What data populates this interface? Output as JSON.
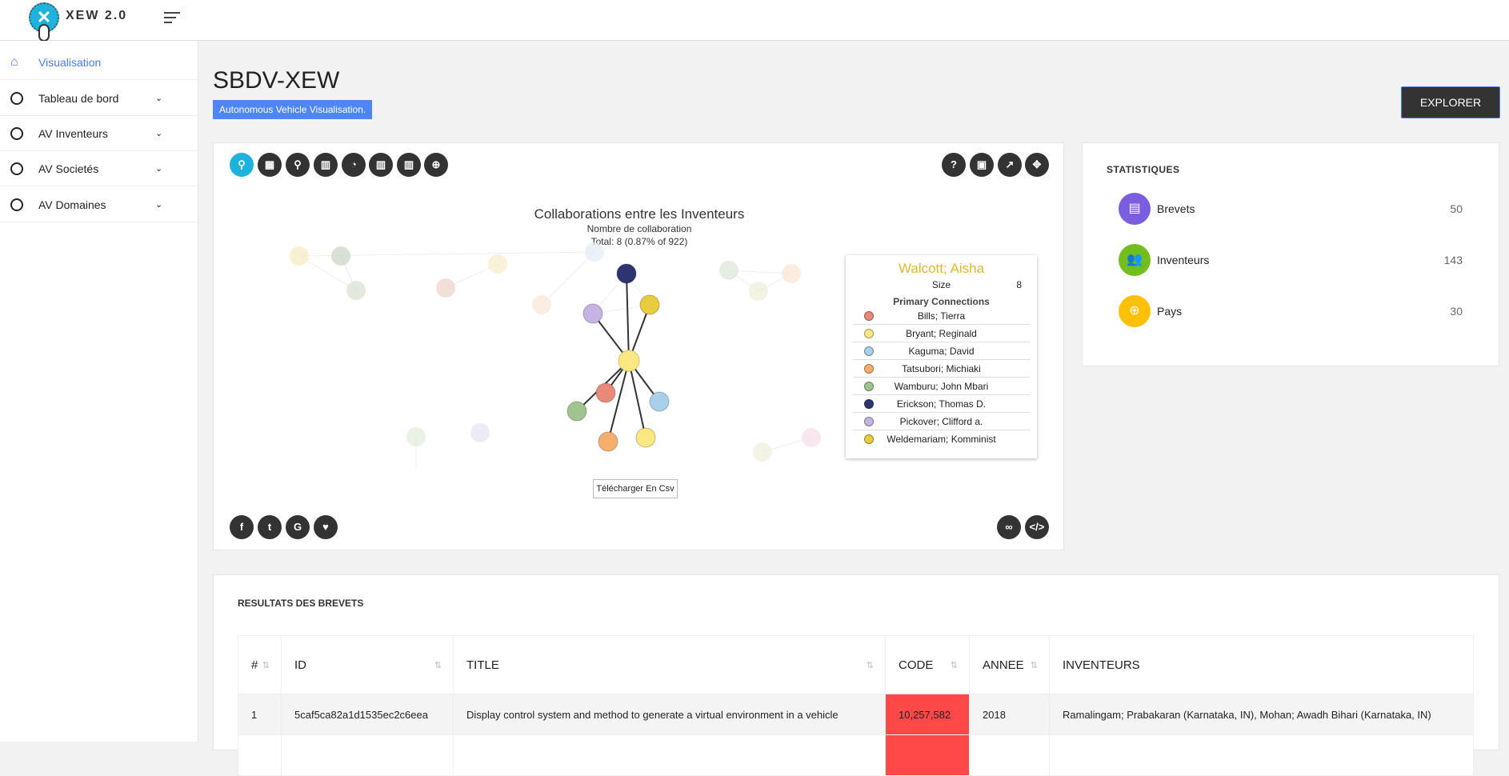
{
  "app": {
    "logo_text": "XEW 2.0"
  },
  "sidebar": {
    "items": [
      {
        "label": "Visualisation",
        "active": true,
        "icon": "home-icon"
      },
      {
        "label": "Tableau de bord",
        "icon": "circle-icon"
      },
      {
        "label": "AV Inventeurs",
        "icon": "circle-icon"
      },
      {
        "label": "AV Societés",
        "icon": "circle-icon"
      },
      {
        "label": "AV Domaines",
        "icon": "circle-icon"
      }
    ]
  },
  "header": {
    "title": "SBDV-XEW",
    "subtitle": "Autonomous Vehicle Visualisation.",
    "explorer_label": "EXPLORER"
  },
  "chart_panel": {
    "toolbar_icons": [
      "network-icon",
      "building-icon",
      "network-icon",
      "bar-chart-icon",
      "pie-chart-icon",
      "bar-chart-icon",
      "bar-chart-icon",
      "globe-icon"
    ],
    "toolbar_right_icons": [
      "help-icon",
      "image-icon",
      "share-icon",
      "move-icon"
    ],
    "social_icons": [
      "facebook-icon",
      "twitter-icon",
      "google-icon",
      "heart-icon"
    ],
    "bottom_right_icons": [
      "link-icon",
      "code-icon"
    ],
    "title": "Collaborations entre les Inventeurs",
    "subtitle": "Nombre de collaboration",
    "total": "Total: 8 (0.87% of 922)",
    "csv_button": "Télécharger En Csv",
    "tooltip": {
      "name": "Walcott; Aisha",
      "size_label": "Size",
      "size_value": "8",
      "connections_label": "Primary Connections",
      "connections": [
        {
          "name": "Bills; Tierra",
          "color": "#e8897a"
        },
        {
          "name": "Bryant; Reginald",
          "color": "#fbe882"
        },
        {
          "name": "Kaguma; David",
          "color": "#a8d0e8"
        },
        {
          "name": "Tatsubori; Michiaki",
          "color": "#f6ae6c"
        },
        {
          "name": "Wamburu; John Mbari",
          "color": "#9fc48e"
        },
        {
          "name": "Erickson; Thomas D.",
          "color": "#2e3470"
        },
        {
          "name": "Pickover; Clifford a.",
          "color": "#c4b3e3"
        },
        {
          "name": "Weldemariam; Komminist",
          "color": "#e8cc3c"
        }
      ]
    }
  },
  "stats": {
    "title": "STATISTIQUES",
    "items": [
      {
        "label": "Brevets",
        "value": "50",
        "color": "#7b5de0",
        "icon": "document-icon"
      },
      {
        "label": "Inventeurs",
        "value": "143",
        "color": "#72be1c",
        "icon": "users-icon"
      },
      {
        "label": "Pays",
        "value": "30",
        "color": "#ffc107",
        "icon": "globe-icon"
      }
    ]
  },
  "results": {
    "title": "RESULTATS DES BREVETS",
    "columns": [
      "#",
      "ID",
      "TITLE",
      "CODE",
      "ANNEE",
      "INVENTEURS"
    ],
    "rows": [
      [
        "1",
        "5caf5ca82a1d1535ec2c6eea",
        "Display control system and method to generate a virtual environment in a vehicle",
        "10,257,582",
        "2018",
        "Ramalingam; Prabakaran (Karnataka, IN), Mohan; Awadh Bihari (Karnataka, IN)"
      ]
    ],
    "code_highlight": "#ff4848"
  }
}
